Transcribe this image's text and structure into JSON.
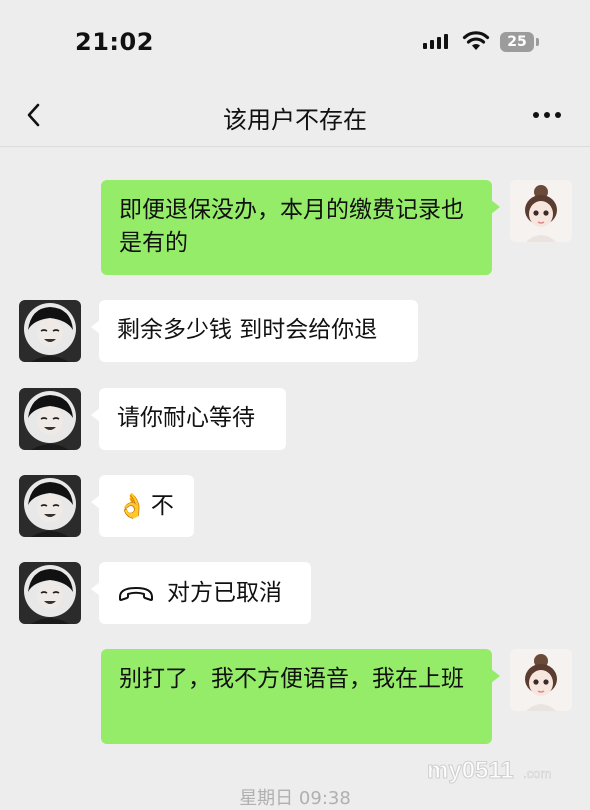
{
  "status_bar": {
    "time": "21:02",
    "battery": "25",
    "signal_icon": "cellular-signal-icon",
    "wifi_icon": "wifi-icon"
  },
  "nav": {
    "title": "该用户不存在",
    "back_icon": "chevron-left-icon",
    "more_icon": "more-dots-icon"
  },
  "messages": [
    {
      "side": "out",
      "text": "即便退保没办，本月的缴费记录也是有的"
    },
    {
      "side": "in",
      "text": "剩余多少钱 到时会给你退"
    },
    {
      "side": "in",
      "text": "请你耐心等待"
    },
    {
      "side": "in",
      "emoji": "👌",
      "text": "不"
    },
    {
      "side": "in",
      "icon": "phone-hangup-icon",
      "text": "对方已取消"
    },
    {
      "side": "out",
      "text": "别打了，我不方便语音，我在上班"
    }
  ],
  "bottom_timestamp": "星期日 09:38",
  "watermark": "my0511.com",
  "colors": {
    "outgoing_bubble": "#95ec69",
    "incoming_bubble": "#ffffff",
    "background": "#ededed"
  }
}
